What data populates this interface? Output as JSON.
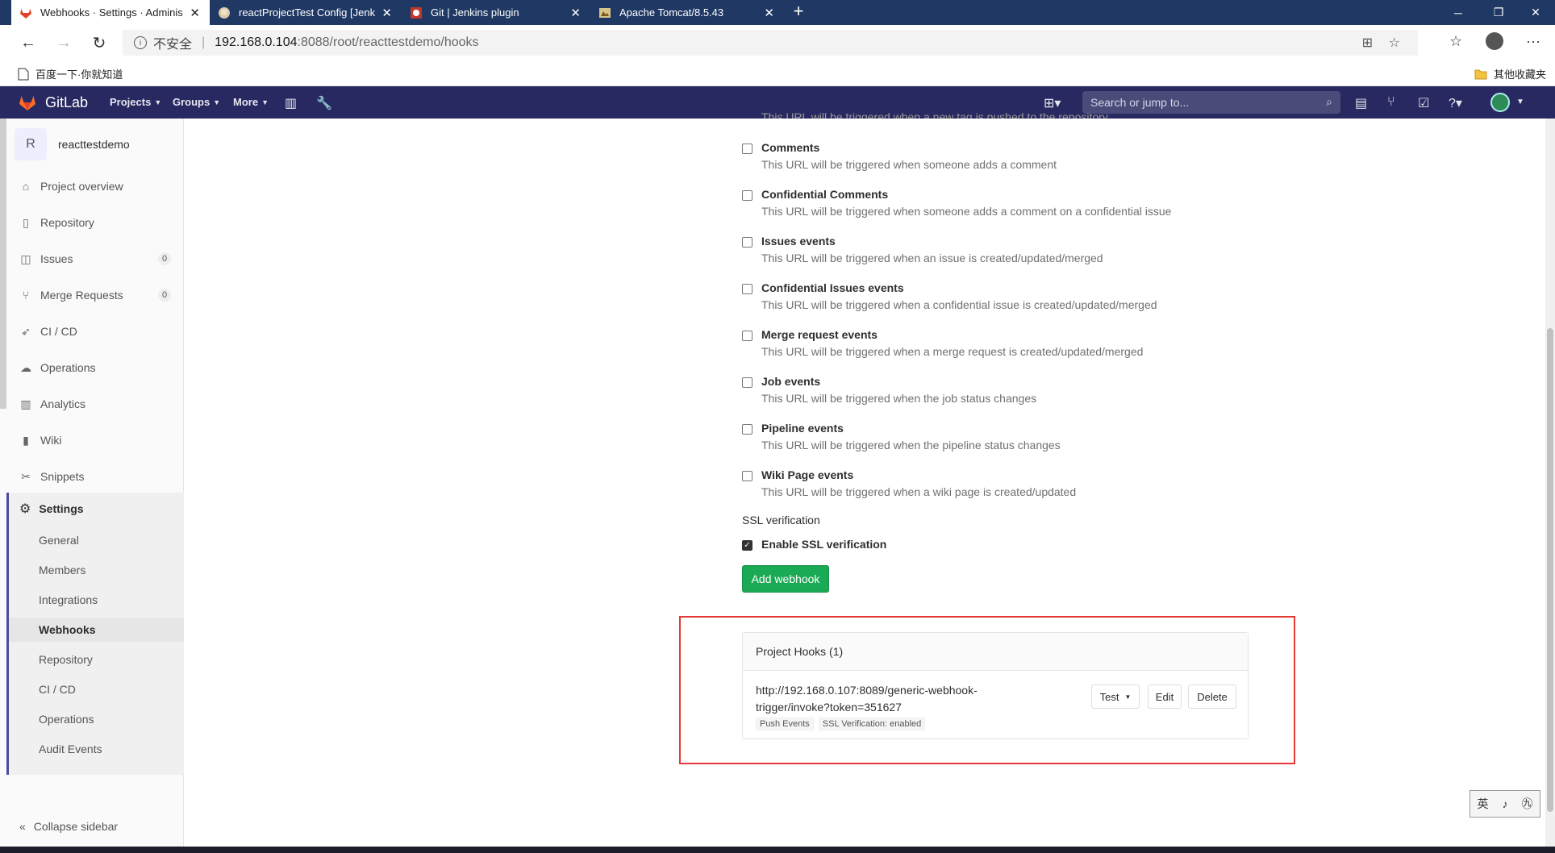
{
  "browser": {
    "tabs": [
      {
        "title": "Webhooks · Settings · Administra",
        "icon": "gitlab-fox-icon",
        "active": true
      },
      {
        "title": "reactProjectTest Config [Jenkins]",
        "icon": "jenkins-icon",
        "active": false
      },
      {
        "title": "Git | Jenkins plugin",
        "icon": "jenkins-plugin-icon",
        "active": false
      },
      {
        "title": "Apache Tomcat/8.5.43",
        "icon": "tomcat-icon",
        "active": false
      }
    ],
    "new_tab": "+",
    "url_insecure": "不安全",
    "url_host": "192.168.0.104",
    "url_path": ":8088/root/reacttestdemo/hooks",
    "bookmarks": [
      {
        "label": "百度一下·你就知道"
      },
      {
        "label": "其他收藏夹"
      }
    ]
  },
  "header": {
    "brand": "GitLab",
    "nav": [
      "Projects",
      "Groups",
      "More"
    ],
    "search_placeholder": "Search or jump to..."
  },
  "sidebar": {
    "project_initial": "R",
    "project_name": "reacttestdemo",
    "items": [
      {
        "label": "Project overview",
        "icon": "home-icon"
      },
      {
        "label": "Repository",
        "icon": "doc-icon"
      },
      {
        "label": "Issues",
        "icon": "issues-icon",
        "count": "0"
      },
      {
        "label": "Merge Requests",
        "icon": "merge-request-icon",
        "count": "0"
      },
      {
        "label": "CI / CD",
        "icon": "rocket-icon"
      },
      {
        "label": "Operations",
        "icon": "cloud-icon"
      },
      {
        "label": "Analytics",
        "icon": "chart-icon"
      },
      {
        "label": "Wiki",
        "icon": "book-icon"
      },
      {
        "label": "Snippets",
        "icon": "scissors-icon"
      }
    ],
    "settings_label": "Settings",
    "settings_sub": [
      "General",
      "Members",
      "Integrations",
      "Webhooks",
      "Repository",
      "CI / CD",
      "Operations",
      "Audit Events"
    ],
    "active_sub": "Webhooks",
    "collapse_label": "Collapse sidebar"
  },
  "main": {
    "cut_text": "This URL will be triggered when a new tag is pushed to the repository",
    "events": [
      {
        "title": "Comments",
        "desc": "This URL will be triggered when someone adds a comment"
      },
      {
        "title": "Confidential Comments",
        "desc": "This URL will be triggered when someone adds a comment on a confidential issue"
      },
      {
        "title": "Issues events",
        "desc": "This URL will be triggered when an issue is created/updated/merged"
      },
      {
        "title": "Confidential Issues events",
        "desc": "This URL will be triggered when a confidential issue is created/updated/merged"
      },
      {
        "title": "Merge request events",
        "desc": "This URL will be triggered when a merge request is created/updated/merged"
      },
      {
        "title": "Job events",
        "desc": "This URL will be triggered when the job status changes"
      },
      {
        "title": "Pipeline events",
        "desc": "This URL will be triggered when the pipeline status changes"
      },
      {
        "title": "Wiki Page events",
        "desc": "This URL will be triggered when a wiki page is created/updated"
      }
    ],
    "ssl_label": "SSL verification",
    "ssl_checkbox_label": "Enable SSL verification",
    "add_button": "Add webhook",
    "hooks_title": "Project Hooks (1)",
    "hook_url_line1": "http://192.168.0.107:8089/generic-webhook-",
    "hook_url_line2": "trigger/invoke?token=351627",
    "hook_tags": [
      "Push Events",
      "SSL Verification: enabled"
    ],
    "test_button": "Test",
    "edit_button": "Edit",
    "delete_button": "Delete"
  },
  "ime": [
    "英",
    "♪",
    "㊈"
  ],
  "colors": {
    "header_bg": "#292961",
    "add_button_bg": "#1aaa55",
    "highlight_border": "#e53935"
  }
}
